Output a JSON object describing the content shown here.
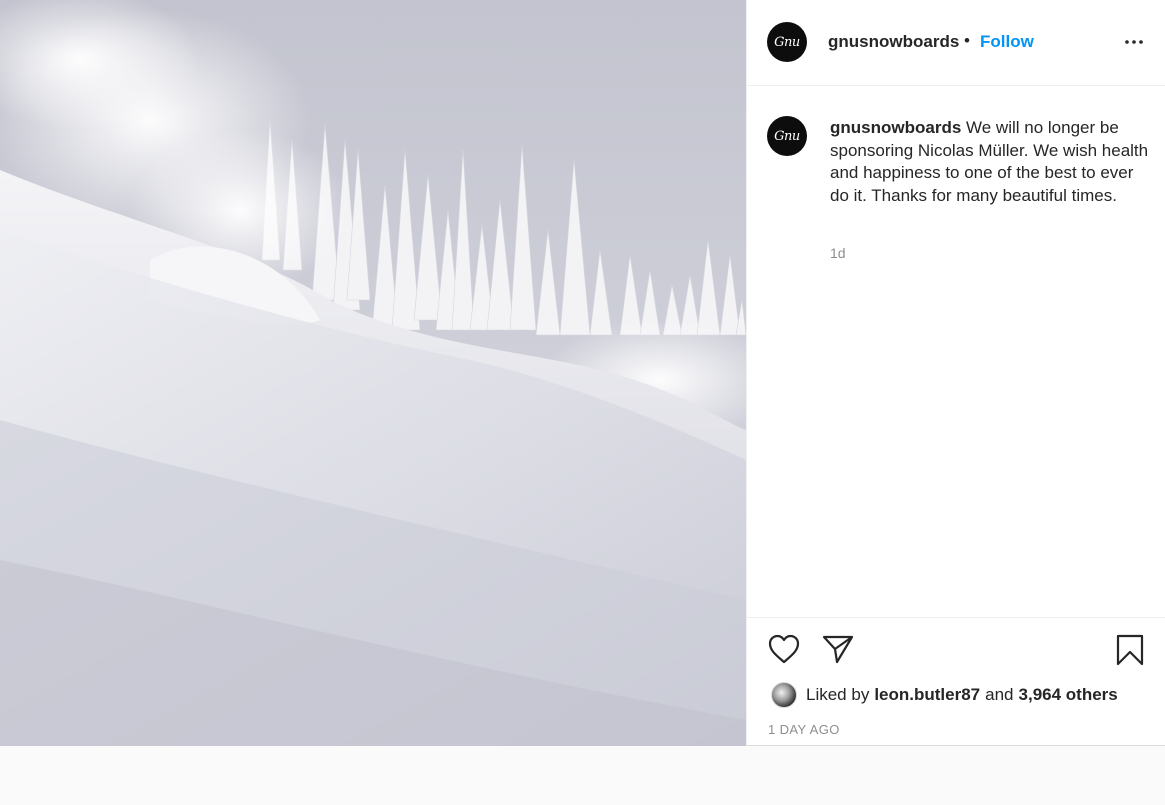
{
  "post": {
    "image": {
      "alt_icon": "snowy-slope-photo"
    },
    "header": {
      "avatar_text": "Gnu",
      "username": "gnusnowboards",
      "separator": "•",
      "follow_label": "Follow",
      "more_icon": "more-horizontal-icon"
    },
    "caption": {
      "avatar_text": "Gnu",
      "username": "gnusnowboards",
      "text": "We will no longer be sponsoring Nicolas Müller. We wish health and happiness to one of the best to ever do it. Thanks for many beautiful times.",
      "time": "1d"
    },
    "actions": {
      "like_icon": "heart-icon",
      "share_icon": "paper-plane-icon",
      "save_icon": "bookmark-icon"
    },
    "likes": {
      "prefix": "Liked by",
      "user": "leon.butler87",
      "joiner": "and",
      "others": "3,964 others"
    },
    "date": "1 DAY AGO"
  },
  "colors": {
    "accent": "#0095f6",
    "text": "#262626",
    "muted": "#8e8e8e",
    "border": "#efefef",
    "background": "#fafafa"
  }
}
